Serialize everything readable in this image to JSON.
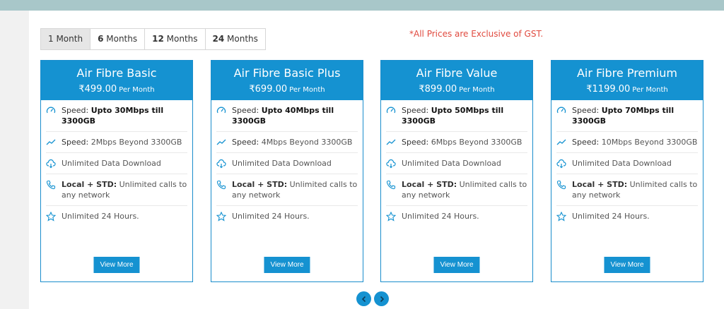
{
  "tabs": [
    {
      "num": "1",
      "unit": " Month"
    },
    {
      "num": "6",
      "unit": " Months"
    },
    {
      "num": "12",
      "unit": " Months"
    },
    {
      "num": "24",
      "unit": " Months"
    }
  ],
  "gst_note": "*All Prices are Exclusive of GST.",
  "cards": [
    {
      "title": "Air Fibre Basic",
      "price": "₹499.00",
      "per": "Per Month",
      "speed_label": "Speed:",
      "speed_value": "Upto 30Mbps till 3300GB",
      "speed2_label": "Speed:",
      "speed2_value": "2Mbps Beyond 3300GB",
      "data": "Unlimited Data Download",
      "calls_label": "Local + STD:",
      "calls_value": "Unlimited calls to any network",
      "hours": "Unlimited 24 Hours.",
      "button": "View More"
    },
    {
      "title": "Air Fibre Basic Plus",
      "price": "₹699.00",
      "per": "Per Month",
      "speed_label": "Speed:",
      "speed_value": "Upto 40Mbps till 3300GB",
      "speed2_label": "Speed:",
      "speed2_value": "4Mbps Beyond 3300GB",
      "data": "Unlimited Data Download",
      "calls_label": "Local + STD:",
      "calls_value": "Unlimited calls to any network",
      "hours": "Unlimited 24 Hours.",
      "button": "View More"
    },
    {
      "title": "Air Fibre Value",
      "price": "₹899.00",
      "per": "Per Month",
      "speed_label": "Speed:",
      "speed_value": "Upto 50Mbps till 3300GB",
      "speed2_label": "Speed:",
      "speed2_value": "6Mbps Beyond 3300GB",
      "data": "Unlimited Data Download",
      "calls_label": "Local + STD:",
      "calls_value": "Unlimited calls to any network",
      "hours": "Unlimited 24 Hours.",
      "button": "View More"
    },
    {
      "title": "Air Fibre Premium",
      "price": "₹1199.00",
      "per": "Per Month",
      "speed_label": "Speed:",
      "speed_value": "Upto 70Mbps till 3300GB",
      "speed2_label": "Speed:",
      "speed2_value": "10Mbps Beyond 3300GB",
      "data": "Unlimited Data Download",
      "calls_label": "Local + STD:",
      "calls_value": "Unlimited calls to any network",
      "hours": "Unlimited 24 Hours.",
      "button": "View More"
    }
  ],
  "colors": {
    "accent": "#1592d1",
    "note": "#e04a3f",
    "topbar": "#a8c7c9"
  },
  "icons": [
    "speedometer-icon",
    "trend-icon",
    "cloud-download-icon",
    "phone-icon",
    "star-icon",
    "chevron-left-icon",
    "chevron-right-icon"
  ]
}
